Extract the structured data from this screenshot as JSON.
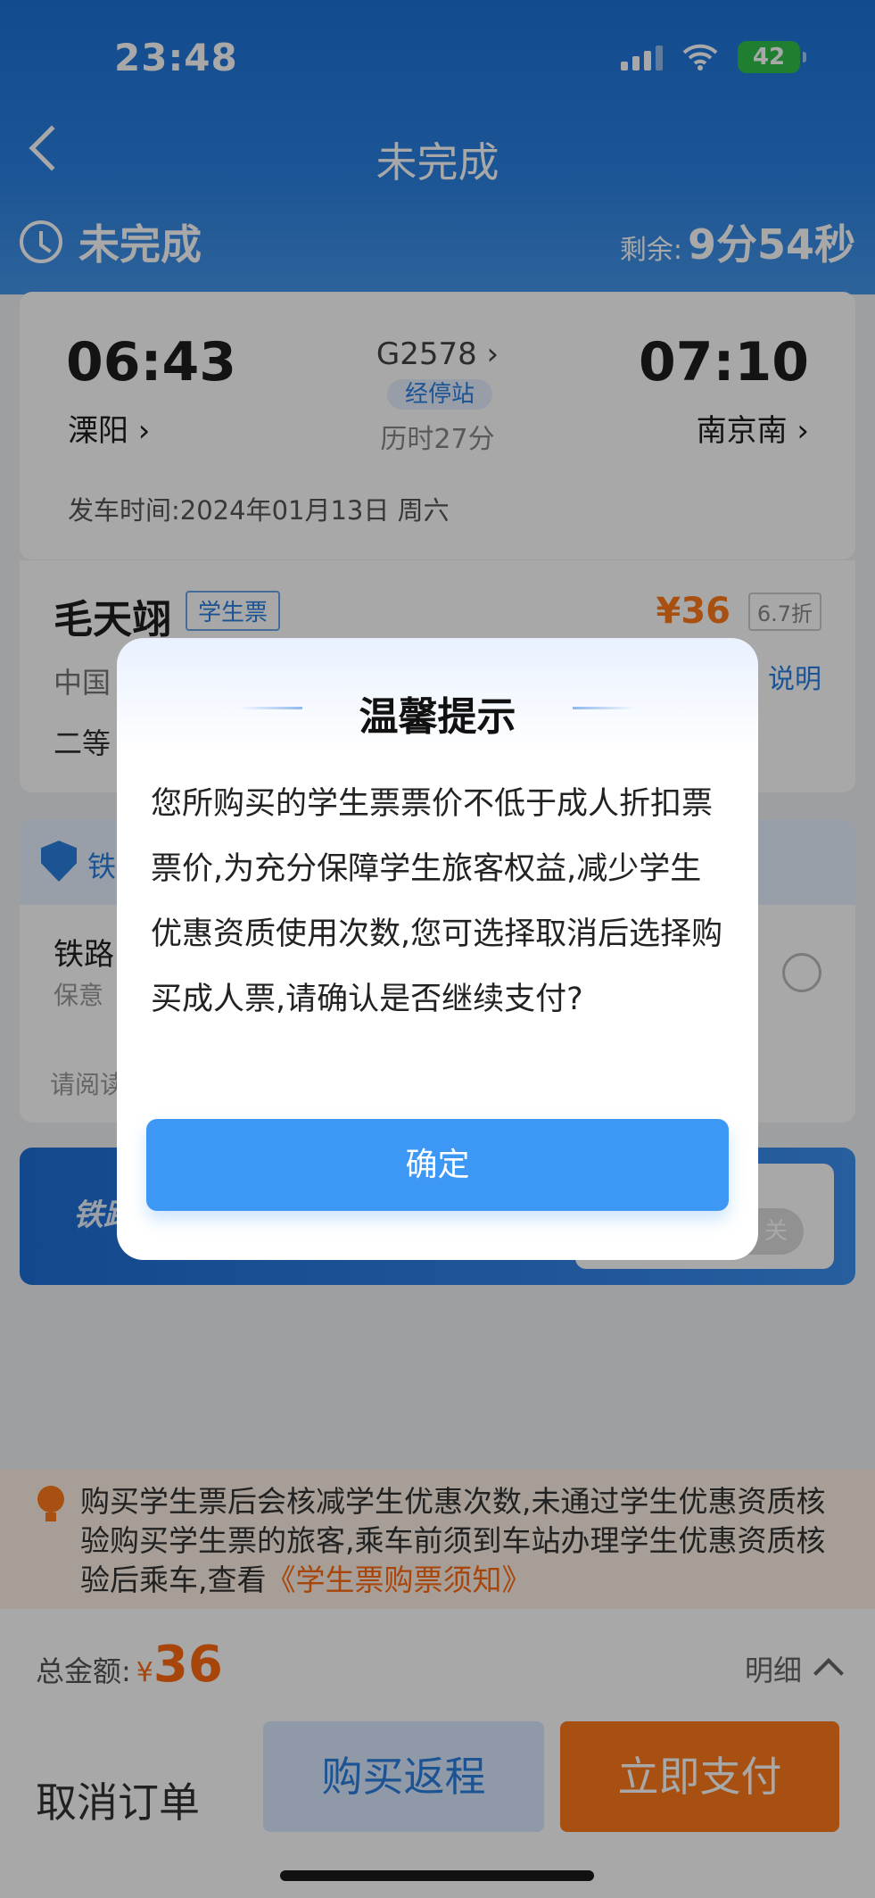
{
  "status_bar": {
    "time": "23:48",
    "battery": "42"
  },
  "nav": {
    "title": "未完成"
  },
  "order_status": {
    "label": "未完成",
    "remaining_label": "剩余:",
    "remaining_time": "9分54秒"
  },
  "trip": {
    "departure_time": "06:43",
    "departure_station": "溧阳",
    "train_number": "G2578",
    "stops_label": "经停站",
    "duration": "历时27分",
    "arrival_time": "07:10",
    "arrival_station": "南京南",
    "departure_date": "发车时间:2024年01月13日 周六"
  },
  "passenger": {
    "name": "毛天翊",
    "ticket_type": "学生票",
    "price": "¥36",
    "discount": "6.7折",
    "id_partial": "中国",
    "explain_partial": "说明",
    "seat_partial": "二等"
  },
  "insurance": {
    "title_partial": "铁",
    "name_partial": "铁路",
    "sub_partial": "保意",
    "read_partial": "请阅读"
  },
  "banner": {
    "text_partial": "铁路",
    "toggle_label": "关"
  },
  "notice": {
    "text": "购买学生票后会核减学生优惠次数,未通过学生优惠资质核验购买学生票的旅客,乘车前须到车站办理学生优惠资质核验后乘车,查看",
    "link": "《学生票购票须知》"
  },
  "bottom": {
    "total_label": "总金额:",
    "currency": "¥",
    "total_value": "36",
    "detail_label": "明细",
    "cancel_label": "取消订单",
    "return_label": "购买返程",
    "pay_label": "立即支付"
  },
  "dialog": {
    "title": "温馨提示",
    "body": "您所购买的学生票票价不低于成人折扣票票价,为充分保障学生旅客权益,减少学生优惠资质使用次数,您可选择取消后选择购买成人票,请确认是否继续支付?",
    "confirm_label": "确定"
  },
  "colors": {
    "primary": "#2b7fe0",
    "accent_orange": "#ff7a1a",
    "confirm_blue": "#3d97f5"
  }
}
